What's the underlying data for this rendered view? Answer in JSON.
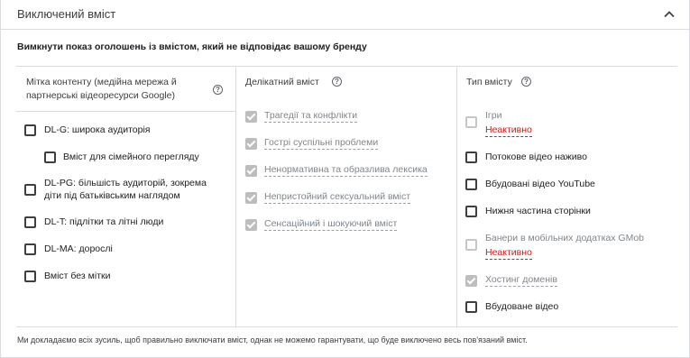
{
  "header": {
    "title": "Виключений вміст",
    "collapse_icon": "chevron-up-icon"
  },
  "subtitle": "Вимкнути показ оголошень із вмістом, який не відповідає вашому бренду",
  "columns": {
    "content_label": {
      "heading": "Мітка контенту (медійна мережа й партнерські відеоресурси Google)",
      "items": [
        {
          "label": "DL-G: широка аудиторія",
          "checked": false
        },
        {
          "label": "Вміст для сімейного перегляду",
          "checked": false
        },
        {
          "label": "DL-PG: більшість аудиторій, зокрема діти під батьківським наглядом",
          "line1": "DL-PG: більшість аудиторій, зокрема",
          "line2": "діти під батьківським наглядом",
          "checked": false
        },
        {
          "label": "DL-T: підлітки та літні люди",
          "checked": false
        },
        {
          "label": "DL-MA: дорослі",
          "checked": false
        },
        {
          "label": "Вміст без мітки",
          "checked": false
        }
      ]
    },
    "sensitive": {
      "heading": "Делікатний вміст",
      "items": [
        {
          "label": "Трагедії та конфлікти",
          "checked": true,
          "disabled": true
        },
        {
          "label": "Гострі суспільні проблеми",
          "checked": true,
          "disabled": true
        },
        {
          "label": "Ненормативна та образлива лексика",
          "checked": true,
          "disabled": true
        },
        {
          "label": "Непристойний сексуальний вміст",
          "checked": true,
          "disabled": true
        },
        {
          "label": "Сенсаційний і шокуючий вміст",
          "checked": true,
          "disabled": true
        }
      ]
    },
    "content_type": {
      "heading": "Тип вмісту",
      "inactive_label": "Неактивно",
      "items": [
        {
          "label": "Ігри",
          "checked": false,
          "disabled": true,
          "status": "Неактивно"
        },
        {
          "label": "Потокове відео наживо",
          "checked": false
        },
        {
          "label": "Вбудовані відео YouTube",
          "checked": false
        },
        {
          "label": "Нижня частина сторінки",
          "checked": false
        },
        {
          "label": "Банери в мобільних додатках GMob",
          "checked": false,
          "disabled": true,
          "status": "Неактивно"
        },
        {
          "label": "Хостинг доменів",
          "checked": true,
          "disabled": true
        },
        {
          "label": "Вбудоване відео",
          "checked": false
        }
      ]
    }
  },
  "help_icon": "help-circle-icon",
  "footer": "Ми докладаємо всіх зусиль, щоб правильно виключати вміст, однак не можемо гарантувати, що буде виключено весь пов'язаний вміст."
}
